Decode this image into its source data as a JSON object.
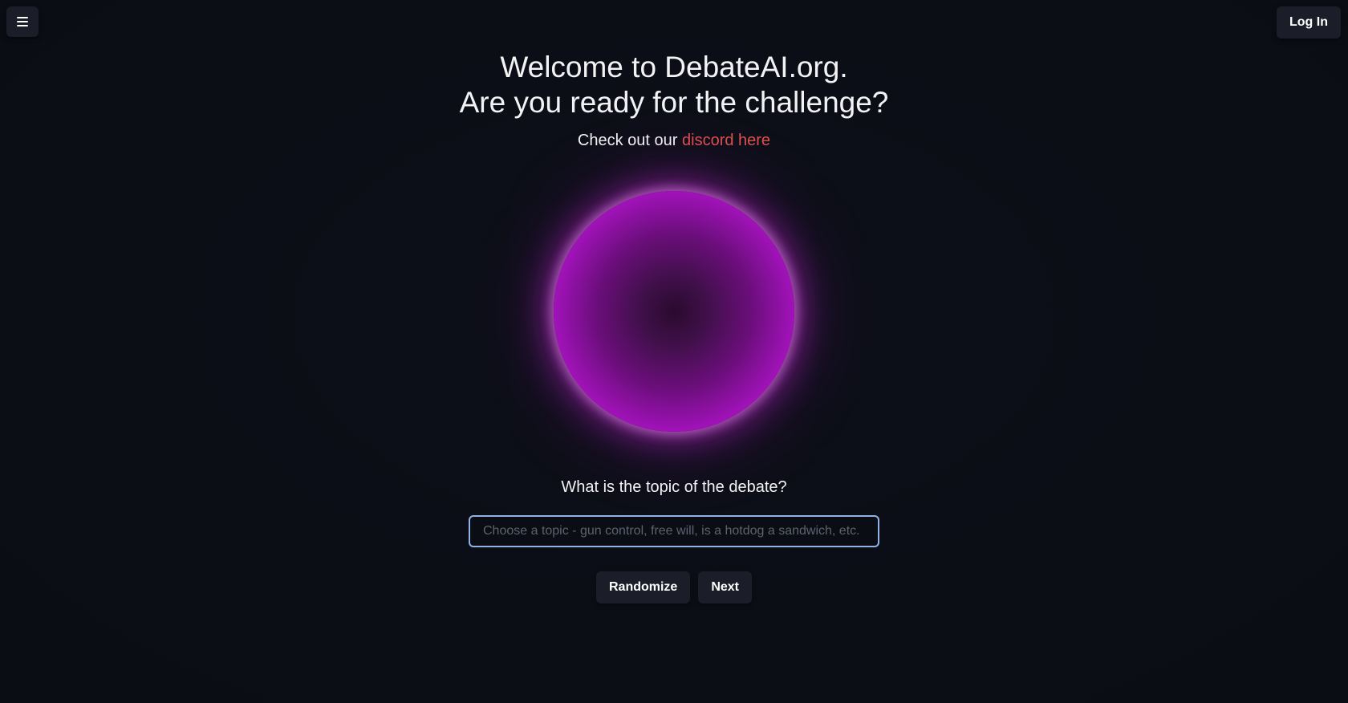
{
  "header": {
    "menu_icon": "hamburger-menu-icon",
    "login_label": "Log In"
  },
  "hero": {
    "title_line1": "Welcome to DebateAI.org.",
    "title_line2": "Are you ready for the challenge?",
    "subline_prefix": "Check out our",
    "subline_link": "discord here"
  },
  "orb": {
    "colors": {
      "core": "#2a0a2e",
      "mid": "#a012b8",
      "rim": "#f2c3f5"
    }
  },
  "topic": {
    "question": "What is the topic of the debate?",
    "placeholder": "Choose a topic - gun control, free will, is a hotdog a sandwich, etc.",
    "value": ""
  },
  "actions": {
    "randomize_label": "Randomize",
    "next_label": "Next"
  },
  "colors": {
    "background": "#0c0e16",
    "link": "#e0514e",
    "button_bg": "#1b1e28",
    "input_border": "#8fb3e4"
  }
}
